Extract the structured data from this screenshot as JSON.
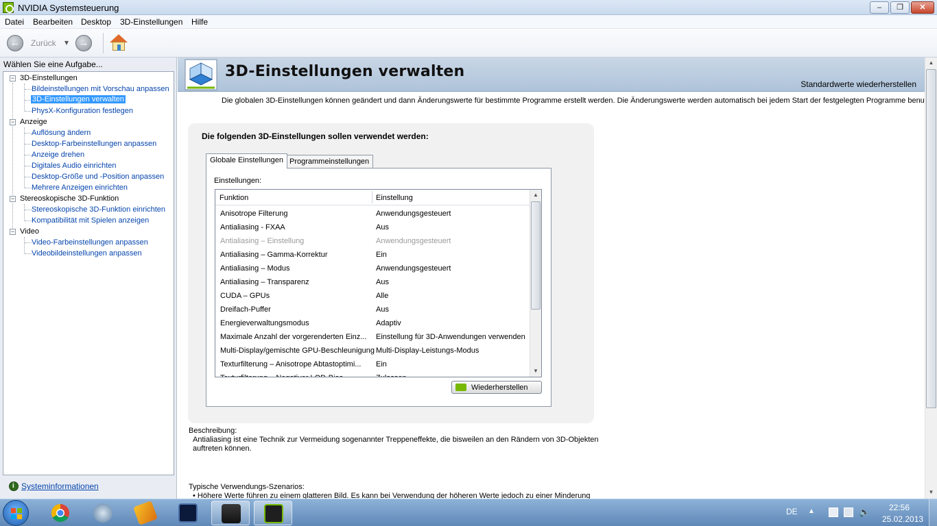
{
  "window": {
    "title": "NVIDIA Systemsteuerung",
    "minimize": "–",
    "maximize": "❐",
    "close": "✕"
  },
  "menu": [
    "Datei",
    "Bearbeiten",
    "Desktop",
    "3D-Einstellungen",
    "Hilfe"
  ],
  "toolbar": {
    "back_label": "Zurück",
    "back_glyph": "←",
    "forward_glyph": "→",
    "dropdown_glyph": "▾"
  },
  "sidebar": {
    "header": "Wählen Sie eine Aufgabe...",
    "groups": [
      {
        "label": "3D-Einstellungen",
        "items": [
          "Bildeinstellungen mit Vorschau anpassen",
          "3D-Einstellungen verwalten",
          "PhysX-Konfiguration festlegen"
        ]
      },
      {
        "label": "Anzeige",
        "items": [
          "Auflösung ändern",
          "Desktop-Farbeinstellungen anpassen",
          "Anzeige drehen",
          "Digitales Audio einrichten",
          "Desktop-Größe und -Position anpassen",
          "Mehrere Anzeigen einrichten"
        ]
      },
      {
        "label": "Stereoskopische 3D-Funktion",
        "items": [
          "Stereoskopische 3D-Funktion einrichten",
          "Kompatibilität mit Spielen anzeigen"
        ]
      },
      {
        "label": "Video",
        "items": [
          "Video-Farbeinstellungen anpassen",
          "Videobildeinstellungen anpassen"
        ]
      }
    ],
    "selected": "3D-Einstellungen verwalten",
    "system_info": "Systeminformationen"
  },
  "main": {
    "title": "3D-Einstellungen verwalten",
    "restore_defaults": "Standardwerte wiederherstellen",
    "intro": "Die globalen 3D-Einstellungen können geändert und dann Änderungswerte für bestimmte Programme erstellt werden. Die Änderungswerte werden automatisch bei jedem Start der festgelegten Programme benutzt.",
    "card_caption": "Die folgenden 3D-Einstellungen sollen verwendet werden:",
    "tabs": [
      "Globale Einstellungen",
      "Programmeinstellungen"
    ],
    "settings_label": "Einstellungen:",
    "table": {
      "headers": [
        "Funktion",
        "Einstellung"
      ],
      "rows": [
        {
          "function": "Anisotrope Filterung",
          "value": "Anwendungsgesteuert",
          "dim": false
        },
        {
          "function": "Antialiasing - FXAA",
          "value": "Aus",
          "dim": false
        },
        {
          "function": "Antialiasing – Einstellung",
          "value": "Anwendungsgesteuert",
          "dim": true
        },
        {
          "function": "Antialiasing – Gamma-Korrektur",
          "value": "Ein",
          "dim": false
        },
        {
          "function": "Antialiasing – Modus",
          "value": "Anwendungsgesteuert",
          "dim": false
        },
        {
          "function": "Antialiasing – Transparenz",
          "value": "Aus",
          "dim": false
        },
        {
          "function": "CUDA – GPUs",
          "value": "Alle",
          "dim": false
        },
        {
          "function": "Dreifach-Puffer",
          "value": "Aus",
          "dim": false
        },
        {
          "function": "Energieverwaltungsmodus",
          "value": "Adaptiv",
          "dim": false
        },
        {
          "function": "Maximale Anzahl der vorgerenderten Einz...",
          "value": "Einstellung für 3D-Anwendungen verwenden",
          "dim": false
        },
        {
          "function": "Multi-Display/gemischte GPU-Beschleunigung",
          "value": "Multi-Display-Leistungs-Modus",
          "dim": false
        },
        {
          "function": "Texturfilterung – Anisotrope Abtastoptimi...",
          "value": "Ein",
          "dim": false
        },
        {
          "function": "Texturfilterung – Negativer LOD-Bias",
          "value": "Zulassen",
          "dim": false
        }
      ]
    },
    "restore_button": "Wiederherstellen",
    "description_header": "Beschreibung:",
    "description_text": "Antialiasing ist eine Technik zur Vermeidung sogenannter Treppeneffekte, die bisweilen an den Rändern von 3D-Objekten auftreten können.",
    "usage_header": "Typische Verwendungs-Szenarios:",
    "usage_text": "• Höhere Werte führen zu einem glatteren Bild. Es kann bei Verwendung der höheren Werte jedoch zu einer Minderung"
  },
  "taskbar": {
    "apps": [
      "internet-explorer-icon",
      "chrome-icon",
      "teamspeak-icon",
      "winamp-icon",
      "monitor-icon",
      "steam-icon",
      "nvidia-icon"
    ],
    "language": "DE",
    "time": "22:56",
    "date": "25.02.2013"
  },
  "colors": {
    "nvidia_green": "#76b900",
    "link_blue": "#0645ad",
    "selection": "#3399ff"
  }
}
